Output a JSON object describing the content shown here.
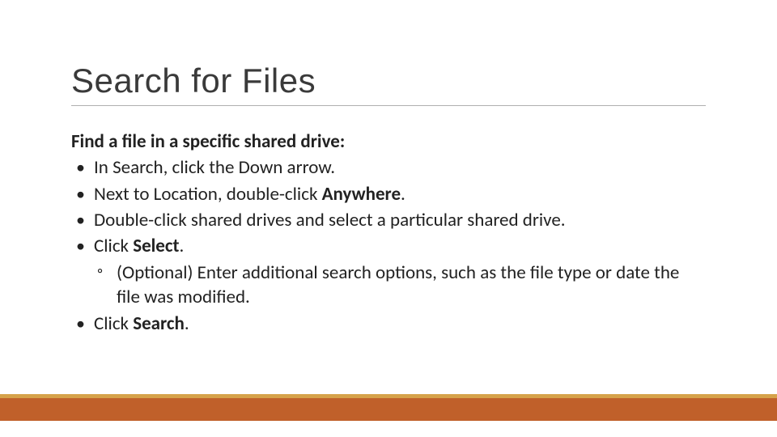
{
  "title": "Search for Files",
  "subheading": "Find a file in a specific shared drive:",
  "bullets": [
    {
      "text": "In Search, click the Down arrow."
    },
    {
      "prefix": "Next to Location, double-click ",
      "bold": "Anywhere",
      "suffix": "."
    },
    {
      "text": "Double-click shared drives and select a particular shared drive."
    },
    {
      "prefix": "Click ",
      "bold": "Select",
      "suffix": ".",
      "sub": [
        {
          "text": "(Optional) Enter additional search options, such as the file type or date the file was modified."
        }
      ]
    },
    {
      "prefix": "Click ",
      "bold": "Search",
      "suffix": "."
    }
  ],
  "colors": {
    "accent_bar": "#c0602a",
    "accent_strip": "#d6a24a"
  }
}
